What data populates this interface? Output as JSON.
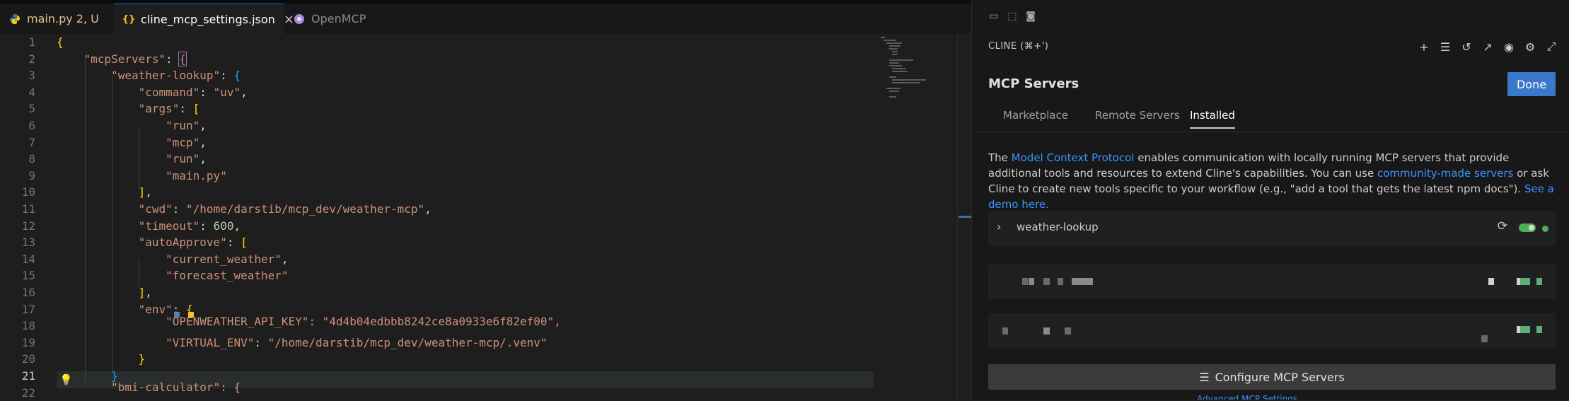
{
  "editor": {
    "tabs": [
      {
        "label": "main.py  2, U",
        "icon": "python-icon"
      },
      {
        "label": "cline_mcp_settings.json",
        "icon": "json-braces-icon"
      },
      {
        "label": "OpenMCP",
        "icon": "openmcp-icon"
      }
    ],
    "lines": [
      {
        "n": "1"
      },
      {
        "n": "2"
      },
      {
        "n": "3"
      },
      {
        "n": "4"
      },
      {
        "n": "5"
      },
      {
        "n": "6"
      },
      {
        "n": "7"
      },
      {
        "n": "8"
      },
      {
        "n": "9"
      },
      {
        "n": "10"
      },
      {
        "n": "11"
      },
      {
        "n": "12"
      },
      {
        "n": "13"
      },
      {
        "n": "14"
      },
      {
        "n": "15"
      },
      {
        "n": "16"
      },
      {
        "n": "17"
      },
      {
        "n": "18"
      },
      {
        "n": "19"
      },
      {
        "n": "20"
      },
      {
        "n": "21"
      },
      {
        "n": "22"
      }
    ],
    "code": {
      "mcpServers": "\"mcpServers\"",
      "weather_lookup": "\"weather-lookup\"",
      "command_key": "\"command\"",
      "command_val": "\"uv\"",
      "args_key": "\"args\"",
      "arg1": "\"run\"",
      "arg2": "\"mcp\"",
      "arg3": "\"run\"",
      "arg4": "\"main.py\"",
      "cwd_key": "\"cwd\"",
      "cwd_val": "\"/home/darstib/mcp_dev/weather-mcp\"",
      "timeout_key": "\"timeout\"",
      "timeout_val": "600",
      "autoapprove_key": "\"autoApprove\"",
      "aa1": "\"current_weather\"",
      "aa2": "\"forecast_weather\"",
      "env_key": "\"env\"",
      "api_key_line": "\"OPENWEATHER_API_KEY\": \"4d4b04edbbb8242ce8a0933e6f82ef00\",",
      "venv_key": "\"VIRTUAL_ENV\"",
      "venv_val": "\"/home/darstib/mcp_dev/weather-mcp/.venv\"",
      "line22": "\"bmi-calculator\": {"
    }
  },
  "panel": {
    "header": "CLINE (⌘+')",
    "title": "MCP Servers",
    "done_label": "Done",
    "tabs": [
      "Marketplace",
      "Remote Servers",
      "Installed"
    ],
    "active_tab": "Installed",
    "description": {
      "p1": "The ",
      "link1": "Model Context Protocol",
      "p2": " enables communication with locally running MCP servers that provide additional tools and resources to extend Cline's capabilities. You can use ",
      "link2": "community-made servers",
      "p3": " or ask Cline to create new tools specific to your workflow (e.g., \"add a tool that gets the latest npm docs\"). ",
      "link3": "See a demo here."
    },
    "server": {
      "name": "weather-lookup",
      "enabled": true,
      "status_color": "#4caf50"
    },
    "configure_label": "Configure MCP Servers",
    "peek_text": "Advanced MCP Settings"
  },
  "colors": {
    "accent": "#3a78c9",
    "link": "#3794ff",
    "success": "#4caf50"
  }
}
